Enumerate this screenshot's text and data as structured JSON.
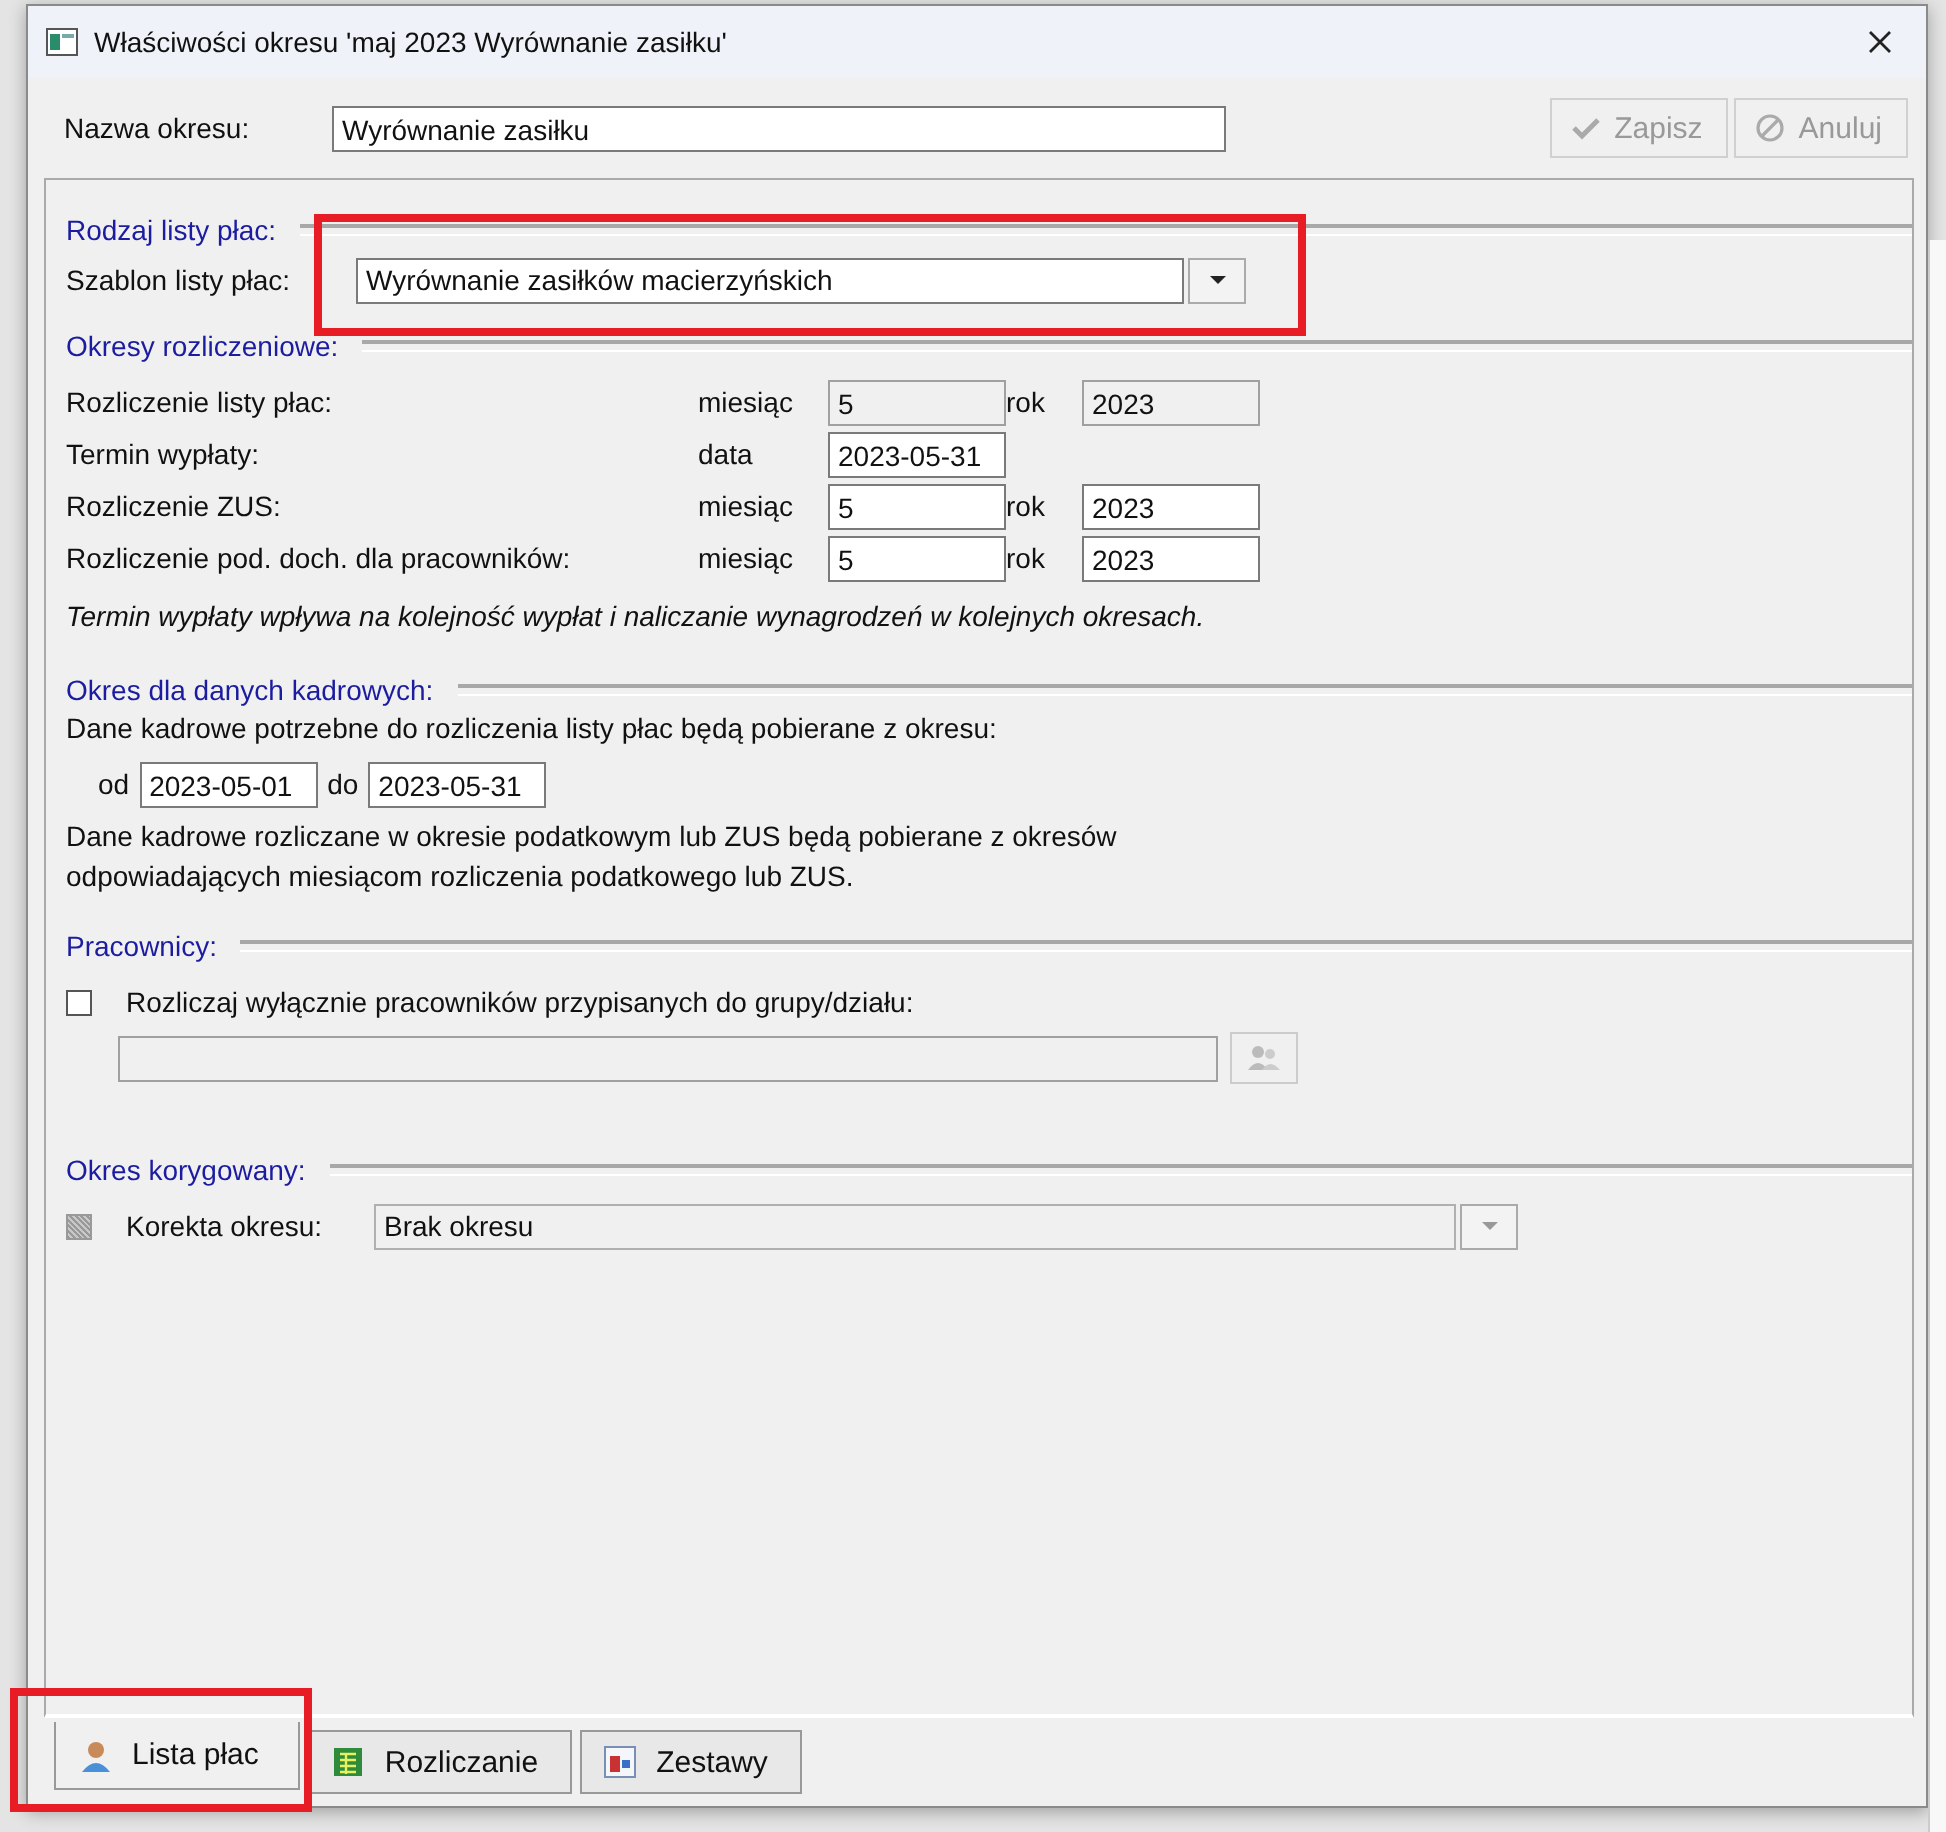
{
  "window": {
    "title": "Właściwości okresu 'maj 2023 Wyrównanie zasiłku'"
  },
  "header": {
    "name_label": "Nazwa okresu:",
    "name_value": "Wyrównanie zasiłku",
    "buttons": [
      {
        "label": "Zapisz",
        "kind": "save",
        "disabled": true
      },
      {
        "label": "Anuluj",
        "kind": "cancel",
        "disabled": true
      }
    ]
  },
  "payroll_type": {
    "heading": "Rodzaj listy płac:",
    "highlighted": true,
    "template_label": "Szablon listy płac:",
    "template_value": "Wyrównanie zasiłków macierzyńskich"
  },
  "settlement_periods": {
    "heading": "Okresy rozliczeniowe:",
    "rows": [
      {
        "label": "Rozliczenie listy płac:",
        "fields": [
          {
            "label": "miesiąc",
            "value": "5",
            "disabled": true
          },
          {
            "label": "rok",
            "value": "2023",
            "disabled": true
          }
        ]
      },
      {
        "label": "Termin wypłaty:",
        "fields": [
          {
            "label": "data",
            "value": "2023-05-31",
            "disabled": false
          }
        ]
      },
      {
        "label": "Rozliczenie ZUS:",
        "fields": [
          {
            "label": "miesiąc",
            "value": "5",
            "disabled": false
          },
          {
            "label": "rok",
            "value": "2023",
            "disabled": false
          }
        ]
      },
      {
        "label": "Rozliczenie pod. doch. dla pracowników:",
        "fields": [
          {
            "label": "miesiąc",
            "value": "5",
            "disabled": false
          },
          {
            "label": "rok",
            "value": "2023",
            "disabled": false
          }
        ]
      }
    ],
    "note": "Termin wypłaty wpływa na kolejność wypłat i naliczanie wynagrodzeń w kolejnych okresach."
  },
  "hr_period": {
    "heading": "Okres dla danych kadrowych:",
    "intro": "Dane kadrowe potrzebne do rozliczenia listy płac będą pobierane z okresu:",
    "from_label": "od",
    "from_value": "2023-05-01",
    "to_label": "do",
    "to_value": "2023-05-31",
    "note_lines": [
      "Dane kadrowe rozliczane w okresie podatkowym lub ZUS będą pobierane z okresów",
      "odpowiadających miesiącom rozliczenia podatkowego lub ZUS."
    ]
  },
  "employees": {
    "heading": "Pracownicy:",
    "checkbox": {
      "label": "Rozliczaj wyłącznie pracowników przypisanych do grupy/działu:",
      "checked": false,
      "disabled": false
    },
    "group_field": {
      "disabled": true
    }
  },
  "corrected_period": {
    "heading": "Okres korygowany:",
    "checkbox": {
      "label": "Korekta okresu:",
      "checked": false,
      "disabled": true
    },
    "select": {
      "value": "Brak okresu",
      "disabled": true
    }
  },
  "tabs": [
    {
      "label": "Lista płac",
      "kind": "person",
      "selected": true,
      "highlighted": true
    },
    {
      "label": "Rozliczanie",
      "kind": "sheet",
      "selected": false,
      "highlighted": false
    },
    {
      "label": "Zestawy",
      "kind": "report",
      "selected": false,
      "highlighted": false
    }
  ]
}
